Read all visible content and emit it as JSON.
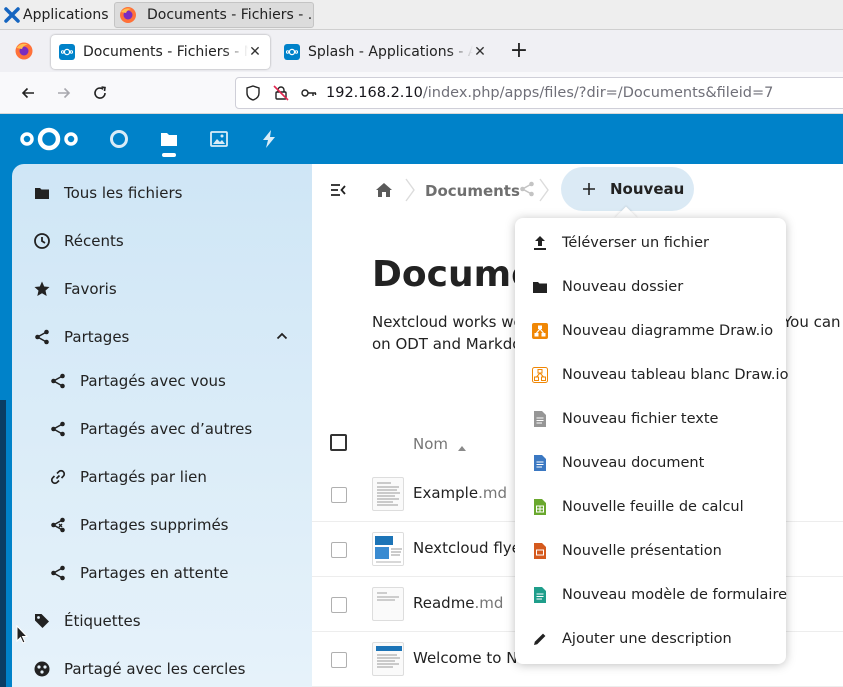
{
  "taskbar": {
    "items": [
      {
        "label": "Applications"
      },
      {
        "label": "Documents - Fichiers - ..."
      }
    ]
  },
  "browser": {
    "tabs": [
      {
        "label": "Documents - Fichiers - Nextcloud",
        "active": true
      },
      {
        "label": "Splash - Applications - Apps",
        "active": false
      }
    ],
    "new_tab": "+",
    "url_host": "192.168.2.10",
    "url_path": "/index.php/apps/files/?dir=/Documents&fileid=7"
  },
  "header": {
    "apps": [
      "dashboard-icon",
      "files-icon",
      "photos-icon",
      "activity-icon"
    ],
    "accent": "#0082c9"
  },
  "sidebar": {
    "items": [
      {
        "label": "Tous les fichiers",
        "icon": "folder-icon"
      },
      {
        "label": "Récents",
        "icon": "clock-icon"
      },
      {
        "label": "Favoris",
        "icon": "star-icon"
      },
      {
        "label": "Partages",
        "icon": "share-icon",
        "expanded": true
      },
      {
        "label": "Partagés avec vous",
        "icon": "share-icon"
      },
      {
        "label": "Partagés avec d’autres",
        "icon": "share-icon"
      },
      {
        "label": "Partagés par lien",
        "icon": "link-icon"
      },
      {
        "label": "Partages supprimés",
        "icon": "share-deleted-icon"
      },
      {
        "label": "Partages en attente",
        "icon": "share-icon"
      },
      {
        "label": "Étiquettes",
        "icon": "tag-icon"
      },
      {
        "label": "Partagé avec les cercles",
        "icon": "circles-icon"
      }
    ]
  },
  "main": {
    "breadcrumb": {
      "current": "Documents"
    },
    "new_button": "Nouveau",
    "title": "Docume",
    "description_line1": "Nextcloud works well",
    "description_line2": "on ODT and Markdow",
    "description_right": "You can e",
    "table": {
      "column_name": "Nom",
      "rows": [
        {
          "name": "Example",
          "ext": ".md"
        },
        {
          "name": "Nextcloud flyer",
          "ext": "."
        },
        {
          "name": "Readme",
          "ext": ".md"
        },
        {
          "name": "Welcome to Nextcloud Hub",
          "ext": ""
        }
      ]
    }
  },
  "new_menu": {
    "items": [
      {
        "label": "Téléverser un fichier",
        "icon": "upload-icon"
      },
      {
        "label": "Nouveau dossier",
        "icon": "folder-icon"
      },
      {
        "label": "Nouveau diagramme Draw.io",
        "icon": "drawio-icon"
      },
      {
        "label": "Nouveau tableau blanc Draw.io",
        "icon": "drawio-whiteboard-icon"
      },
      {
        "label": "Nouveau fichier texte",
        "icon": "text-file-icon"
      },
      {
        "label": "Nouveau document",
        "icon": "document-icon"
      },
      {
        "label": "Nouvelle feuille de calcul",
        "icon": "spreadsheet-icon"
      },
      {
        "label": "Nouvelle présentation",
        "icon": "presentation-icon"
      },
      {
        "label": "Nouveau modèle de formulaire",
        "icon": "form-template-icon"
      },
      {
        "label": "Ajouter une description",
        "icon": "pencil-icon"
      }
    ]
  }
}
